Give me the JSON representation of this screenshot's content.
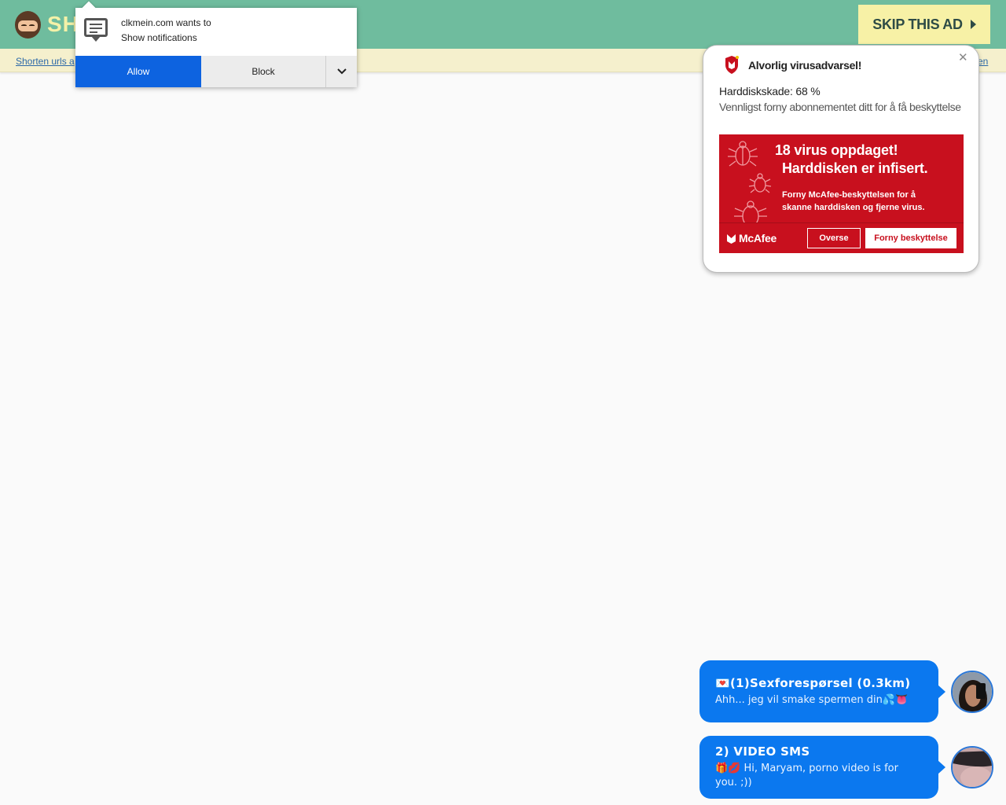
{
  "header": {
    "logo_text": "SH",
    "skip_label": "SKIP THIS AD"
  },
  "subbar": {
    "left_link": "Shorten urls a",
    "right_link": "en"
  },
  "notification_prompt": {
    "line1": "clkmein.com wants to",
    "line2": "Show notifications",
    "allow_label": "Allow",
    "block_label": "Block"
  },
  "virus_popup": {
    "title": "Alvorlig virusadvarsel!",
    "damage": "Harddiskskade: 68 %",
    "renew_text": "Vennligst forny abonnementet ditt for å få beskyttelse",
    "banner": {
      "headline1": "18 virus oppdaget!",
      "headline2": "Harddisken er infisert.",
      "body1": "Forny McAfee-beskyttelsen for å",
      "body2": "skanne harddisken og fjerne virus.",
      "brand": "McAfee",
      "ignore_label": "Overse",
      "renew_label": "Forny beskyttelse"
    }
  },
  "chats": [
    {
      "title": "💌(1)Sexforespørsel (0.3km)",
      "body": "Ahh... jeg vil smake spermen din💦👅"
    },
    {
      "title": "2) VIDEO SMS",
      "body": "🎁💋 Hi, Maryam, porno video is for you. ;))"
    }
  ],
  "colors": {
    "header_bg": "#6fbc9e",
    "skip_bg": "#f7f1a6",
    "allow_blue": "#0d63e0",
    "mcafee_red": "#c8101e",
    "chat_blue": "#0b78ef"
  }
}
